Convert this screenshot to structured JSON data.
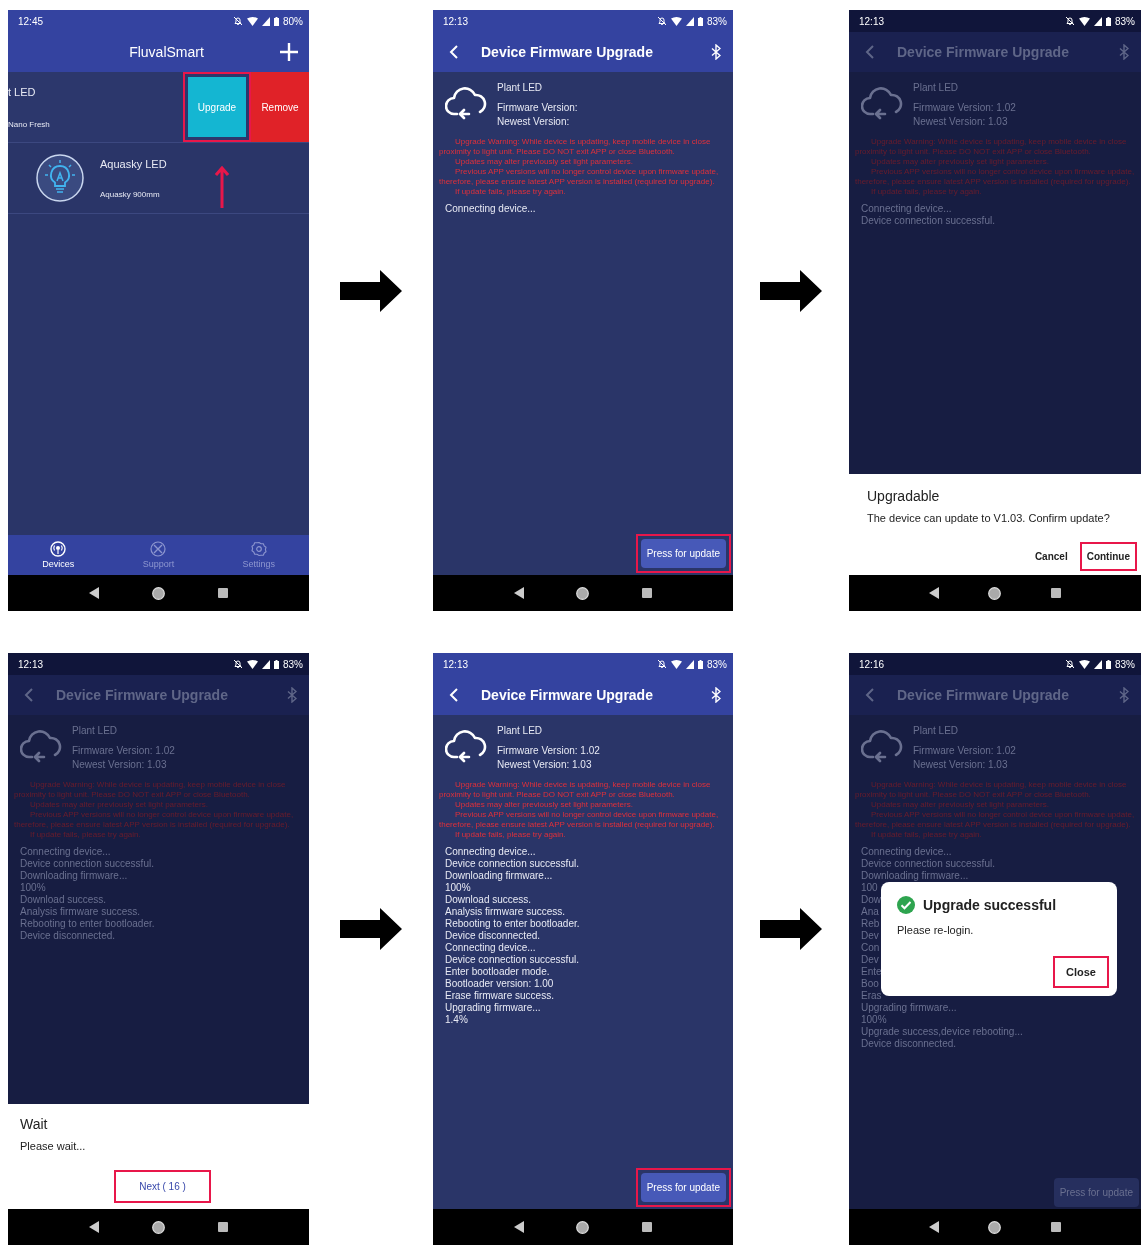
{
  "screens": [
    {
      "kind": "device_list",
      "dimmed": false,
      "status": {
        "time": "12:45",
        "battery": "80%"
      },
      "header": {
        "title": "FluvalSmart"
      },
      "devices": [
        {
          "kind": "swiped",
          "name": "t LED",
          "model": "Nano Fresh",
          "actions": [
            {
              "kind": "upgrade",
              "label": "Upgrade",
              "highlighted": true
            },
            {
              "kind": "remove",
              "label": "Remove",
              "highlighted": false
            }
          ]
        },
        {
          "kind": "normal",
          "name": "Aquasky LED",
          "model": "Aquasky 900mm"
        }
      ],
      "tabs": [
        {
          "label": "Devices",
          "selected": true
        },
        {
          "label": "Support",
          "selected": false
        },
        {
          "label": "Settings",
          "selected": false
        }
      ]
    },
    {
      "kind": "firmware",
      "dimmed": false,
      "status": {
        "time": "12:13",
        "battery": "83%"
      },
      "header": {
        "title": "Device Firmware Upgrade"
      },
      "device": "Plant LED",
      "firmware_version": "Firmware Version:",
      "newest_version": "Newest Version:",
      "warnings": [
        "Upgrade Warning: While device is updating, keep mobile device in close proximity to light unit. Please DO NOT exit APP or close Bluetooth.",
        "Updates may alter previously set light parameters.",
        "Previous APP versions will no longer control device upon firmware update, therefore, please ensure latest APP version is installed (required for upgrade).",
        "If update fails, please try again."
      ],
      "log": [
        "Connecting device..."
      ],
      "update_button": {
        "label": "Press for update",
        "highlighted": true
      }
    },
    {
      "kind": "firmware",
      "dimmed": true,
      "status": {
        "time": "12:13",
        "battery": "83%"
      },
      "header": {
        "title": "Device Firmware Upgrade"
      },
      "device": "Plant LED",
      "firmware_version": "Firmware Version: 1.02",
      "newest_version": "Newest Version: 1.03",
      "warnings": [
        "Upgrade Warning: While device is updating, keep mobile device in close proximity to light unit. Please DO NOT exit APP or close Bluetooth.",
        "Updates may alter previously set light parameters.",
        "Previous APP versions will no longer control device upon firmware update, therefore, please ensure latest APP version is installed (required for upgrade).",
        "If update fails, please try again."
      ],
      "log": [
        "Connecting device...",
        "Device connection successful."
      ],
      "dialog": {
        "kind": "sheet",
        "title": "Upgradable",
        "message": "The device can update to V1.03. Confirm update?",
        "buttons": [
          {
            "label": "Cancel",
            "highlighted": false
          },
          {
            "label": "Continue",
            "highlighted": true
          }
        ]
      }
    },
    {
      "kind": "firmware",
      "dimmed": true,
      "status": {
        "time": "12:13",
        "battery": "83%"
      },
      "header": {
        "title": "Device Firmware Upgrade"
      },
      "device": "Plant LED",
      "firmware_version": "Firmware Version: 1.02",
      "newest_version": "Newest Version: 1.03",
      "warnings": [
        "Upgrade Warning: While device is updating, keep mobile device in close proximity to light unit. Please DO NOT exit APP or close Bluetooth.",
        "Updates may alter previously set light parameters.",
        "Previous APP versions will no longer control device upon firmware update, therefore, please ensure latest APP version is installed (required for upgrade).",
        "If update fails, please try again."
      ],
      "log": [
        "Connecting device...",
        "Device connection successful.",
        "Downloading firmware...",
        "100%",
        "Download success.",
        "Analysis firmware success.",
        "Rebooting to enter bootloader.",
        "Device disconnected."
      ],
      "dialog": {
        "kind": "sheet",
        "title": "Wait",
        "message": "Please wait...",
        "buttons": [
          {
            "label": "Next ( 16 )",
            "highlighted": true
          }
        ]
      }
    },
    {
      "kind": "firmware",
      "dimmed": false,
      "status": {
        "time": "12:13",
        "battery": "83%"
      },
      "header": {
        "title": "Device Firmware Upgrade"
      },
      "device": "Plant LED",
      "firmware_version": "Firmware Version: 1.02",
      "newest_version": "Newest Version: 1.03",
      "warnings": [
        "Upgrade Warning: While device is updating, keep mobile device in close proximity to light unit. Please DO NOT exit APP or close Bluetooth.",
        "Updates may alter previously set light parameters.",
        "Previous APP versions will no longer control device upon firmware update, therefore, please ensure latest APP version is installed (required for upgrade).",
        "If update fails, please try again."
      ],
      "log": [
        "Connecting device...",
        "Device connection successful.",
        "Downloading firmware...",
        "100%",
        "Download success.",
        "Analysis firmware success.",
        "Rebooting to enter bootloader.",
        "Device disconnected.",
        "Connecting device...",
        "Device connection successful.",
        "Enter bootloader mode.",
        "Bootloader version: 1.00",
        "Erase firmware success.",
        "Upgrading firmware...",
        "1.4%"
      ],
      "update_button": {
        "label": "Press for update",
        "highlighted": true
      }
    },
    {
      "kind": "firmware",
      "dimmed": true,
      "status": {
        "time": "12:16",
        "battery": "83%"
      },
      "header": {
        "title": "Device Firmware Upgrade"
      },
      "device": "Plant LED",
      "firmware_version": "Firmware Version: 1.02",
      "newest_version": "Newest Version: 1.03",
      "warnings": [
        "Upgrade Warning: While device is updating, keep mobile device in close proximity to light unit. Please DO NOT exit APP or close Bluetooth.",
        "Updates may alter previously set light parameters.",
        "Previous APP versions will no longer control device upon firmware update, therefore, please ensure latest APP version is installed (required for upgrade).",
        "If update fails, please try again."
      ],
      "log": [
        "Connecting device...",
        "Device connection successful.",
        "Downloading firmware...",
        "100",
        "Dow",
        "Ana",
        "Reb",
        "Dev",
        "Con",
        "Dev",
        "Ente",
        "Boo",
        "Eras",
        "Upgrading firmware...",
        "100%",
        "Upgrade success,device rebooting...",
        "Device disconnected."
      ],
      "update_button": {
        "label": "Press for update",
        "highlighted": false
      },
      "dialog": {
        "kind": "card",
        "title": "Upgrade successful",
        "message": "Please re-login.",
        "buttons": [
          {
            "label": "Close",
            "highlighted": true
          }
        ]
      }
    }
  ]
}
